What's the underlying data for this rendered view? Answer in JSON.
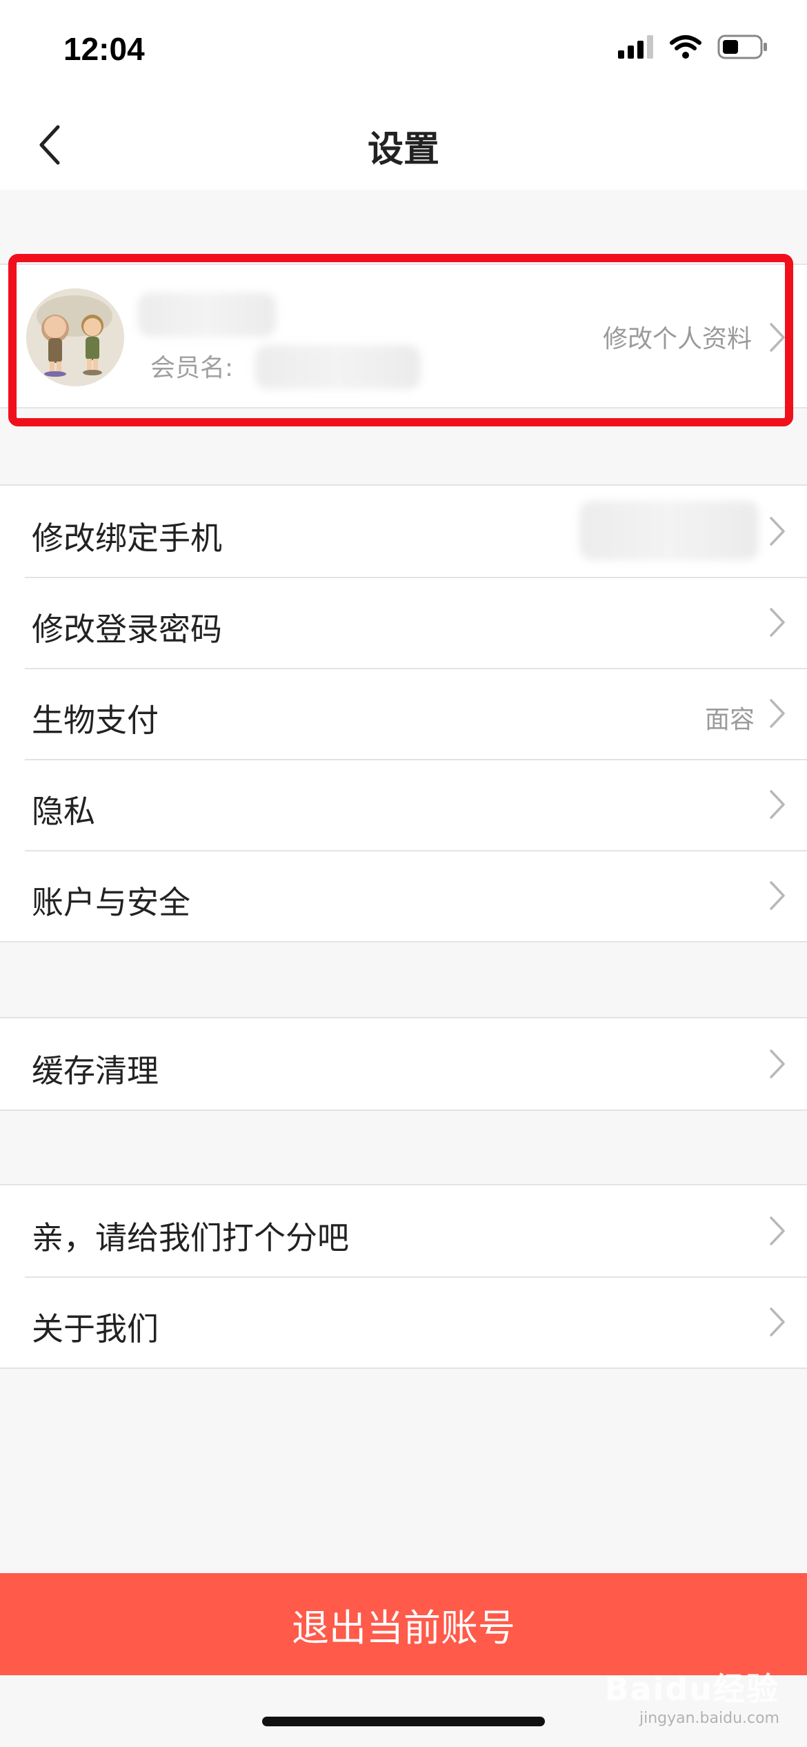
{
  "status_bar": {
    "time": "12:04"
  },
  "nav": {
    "title": "设置"
  },
  "profile": {
    "member_label": "会员名:",
    "edit_label": "修改个人资料"
  },
  "groups": [
    {
      "items": [
        {
          "label": "修改绑定手机",
          "value": ""
        },
        {
          "label": "修改登录密码",
          "value": ""
        },
        {
          "label": "生物支付",
          "value": "面容"
        },
        {
          "label": "隐私",
          "value": ""
        },
        {
          "label": "账户与安全",
          "value": ""
        }
      ]
    },
    {
      "items": [
        {
          "label": "缓存清理",
          "value": ""
        }
      ]
    },
    {
      "items": [
        {
          "label": "亲，请给我们打个分吧",
          "value": ""
        },
        {
          "label": "关于我们",
          "value": ""
        }
      ]
    }
  ],
  "logout": {
    "label": "退出当前账号"
  },
  "watermark": {
    "main": "Baidu经验",
    "sub": "jingyan.baidu.com"
  },
  "colors": {
    "accent": "#ff5a4a",
    "highlight": "#f0101c"
  }
}
